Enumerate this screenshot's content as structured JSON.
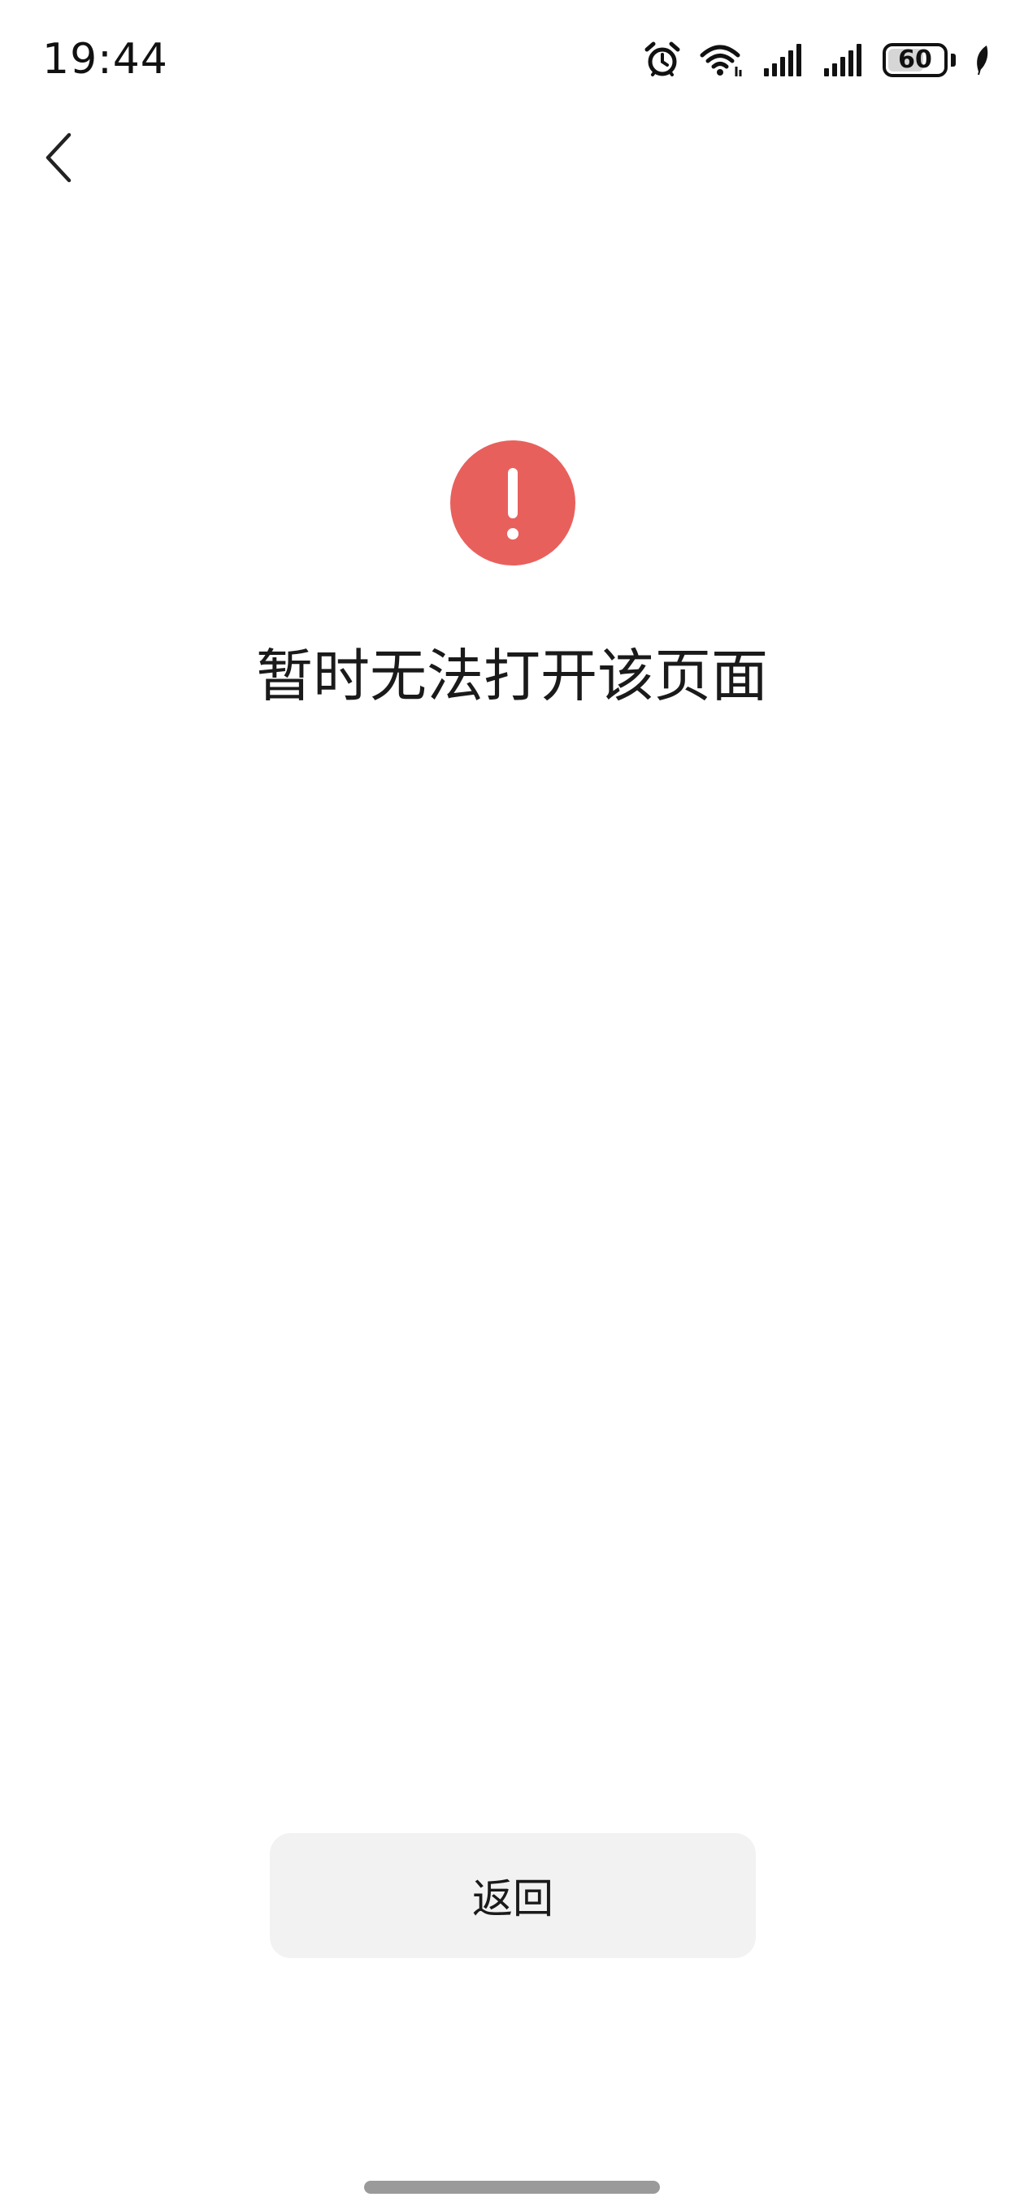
{
  "status_bar": {
    "time": "19:44",
    "battery_level": "60",
    "icons": [
      "alarm-icon",
      "wifi-icon",
      "signal-icon",
      "signal-icon",
      "battery-icon",
      "leaf-icon"
    ]
  },
  "nav": {
    "back_icon": "chevron-left-icon"
  },
  "error": {
    "icon": "exclamation-circle-icon",
    "icon_color": "#e8605c",
    "message": "暂时无法打开该页面"
  },
  "actions": {
    "return_label": "返回",
    "return_bg": "#f2f2f2"
  }
}
